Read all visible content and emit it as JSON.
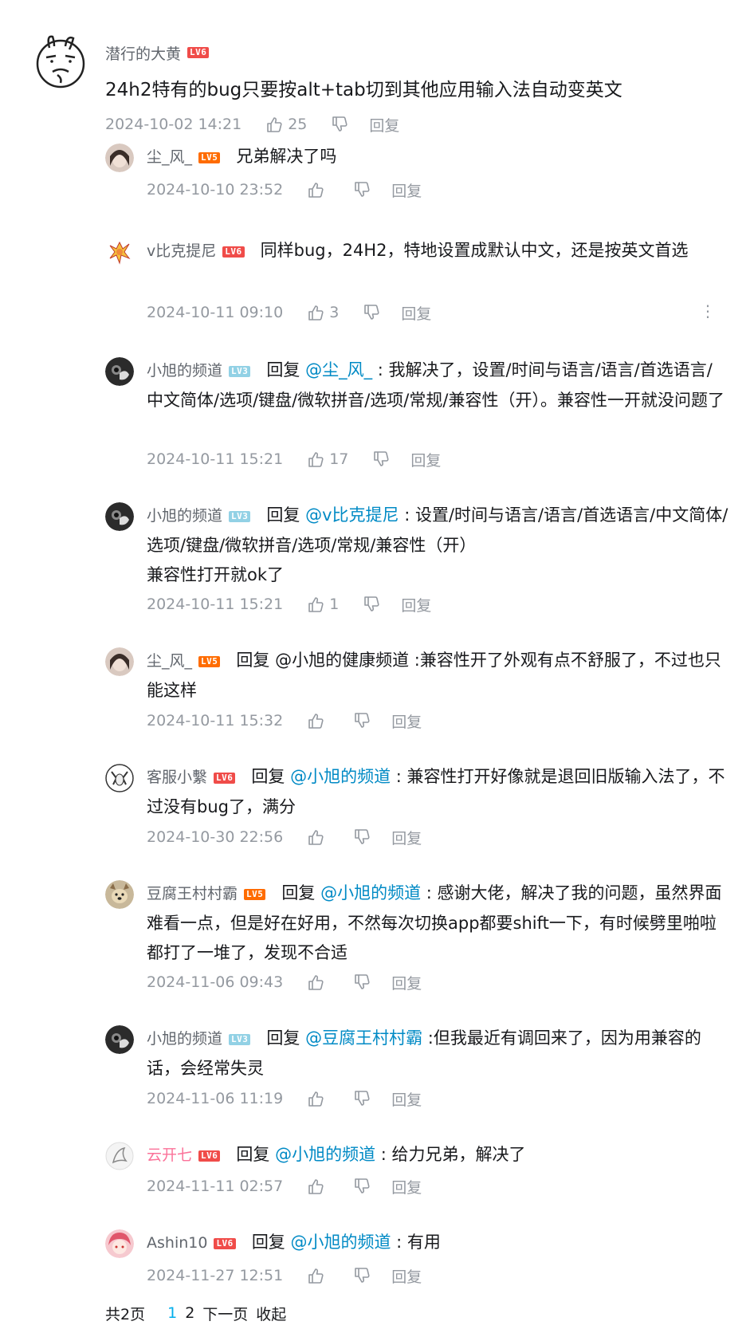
{
  "colors": {
    "accent": "#00aeec",
    "at_link": "#008ac5",
    "meta_gray": "#9499a0",
    "lv6": "#f04c49",
    "lv5": "#ff6c00",
    "lv3": "#92d1e5"
  },
  "main": {
    "user": "潜行的大黄",
    "level": "LV6",
    "text": "24h2特有的bug只要按alt+tab切到其他应用输入法自动变英文",
    "time": "2024-10-02 14:21",
    "likes": "25",
    "reply_label": "回复"
  },
  "replies": [
    {
      "user": "尘_风_",
      "level": "LV5",
      "prefix": "",
      "at": "",
      "text": "兄弟解决了吗",
      "time": "2024-10-10 23:52",
      "likes": "",
      "reply_label": "回复"
    },
    {
      "user": "v比克提尼",
      "level": "LV6",
      "prefix": "",
      "at": "",
      "text": "同样bug，24H2，特地设置成默认中文，还是按英文首选",
      "time": "2024-10-11 09:10",
      "likes": "3",
      "reply_label": "回复"
    },
    {
      "user": "小旭的频道",
      "level": "LV3",
      "prefix": "回复 ",
      "at": "@尘_风_",
      "text": " : 我解决了，设置/时间与语言/语言/首选语言/中文简体/选项/键盘/微软拼音/选项/常规/兼容性（开）。兼容性一开就没问题了",
      "time": "2024-10-11 15:21",
      "likes": "17",
      "reply_label": "回复"
    },
    {
      "user": "小旭的频道",
      "level": "LV3",
      "prefix": "回复 ",
      "at": "@v比克提尼",
      "text": " : 设置/时间与语言/语言/首选语言/中文简体/选项/键盘/微软拼音/选项/常规/兼容性（开）",
      "text2": "兼容性打开就ok了",
      "time": "2024-10-11 15:21",
      "likes": "1",
      "reply_label": "回复"
    },
    {
      "user": "尘_风_",
      "level": "LV5",
      "prefix": "回复 @小旭的健康频道 :",
      "at": "",
      "text": "兼容性开了外观有点不舒服了，不过也只能这样",
      "time": "2024-10-11 15:32",
      "likes": "",
      "reply_label": "回复"
    },
    {
      "user": "客服小繫",
      "level": "LV6",
      "prefix": "回复 ",
      "at": "@小旭的频道",
      "text": " : 兼容性打开好像就是退回旧版输入法了，不过没有bug了，满分",
      "time": "2024-10-30 22:56",
      "likes": "",
      "reply_label": "回复"
    },
    {
      "user": "豆腐王村村霸",
      "level": "LV5",
      "prefix": "回复 ",
      "at": "@小旭的频道",
      "text": " : 感谢大佬，解决了我的问题，虽然界面难看一点，但是好在好用，不然每次切换app都要shift一下，有时候劈里啪啦都打了一堆了，发现不合适",
      "time": "2024-11-06 09:43",
      "likes": "",
      "reply_label": "回复"
    },
    {
      "user": "小旭的频道",
      "level": "LV3",
      "prefix": "回复 ",
      "at": "@豆腐王村村霸",
      "text": " :但我最近有调回来了，因为用兼容的话，会经常失灵",
      "time": "2024-11-06 11:19",
      "likes": "",
      "reply_label": "回复"
    },
    {
      "user": "云开七",
      "level": "LV6",
      "prefix": "回复 ",
      "at": "@小旭的频道",
      "text": " : 给力兄弟，解决了",
      "time": "2024-11-11 02:57",
      "likes": "",
      "reply_label": "回复"
    },
    {
      "user": "Ashin10",
      "level": "LV6",
      "prefix": "回复 ",
      "at": "@小旭的频道",
      "text": " : 有用",
      "time": "2024-11-27 12:51",
      "likes": "",
      "reply_label": "回复"
    }
  ],
  "pagination": {
    "total": "共2页",
    "page1": "1",
    "page2": "2",
    "next": "下一页",
    "collapse": "收起"
  }
}
